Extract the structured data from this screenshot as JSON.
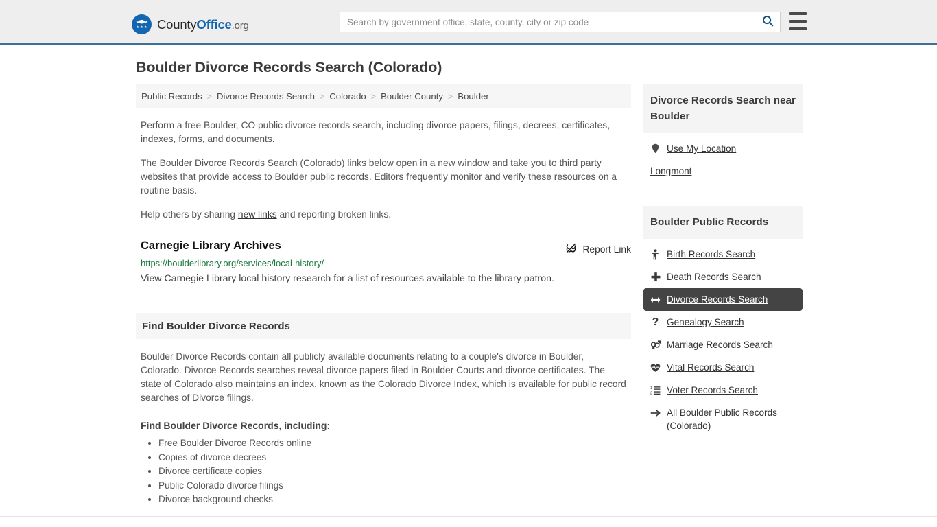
{
  "header": {
    "logo": {
      "icon": "eagle-seal-icon",
      "text_county": "County",
      "text_office": "Office",
      "text_org": ".org"
    },
    "search": {
      "placeholder": "Search by government office, state, county, city or zip code",
      "value": "",
      "icon": "search-icon"
    },
    "menu_icon": "hamburger-menu-icon",
    "accent_color": "#3b7196"
  },
  "main": {
    "title": "Boulder Divorce Records Search (Colorado)",
    "breadcrumb": {
      "separator": ">",
      "items": [
        {
          "label": "Public Records"
        },
        {
          "label": "Divorce Records Search"
        },
        {
          "label": "Colorado"
        },
        {
          "label": "Boulder County"
        },
        {
          "label": "Boulder"
        }
      ]
    },
    "intro_paragraph": "Perform a free Boulder, CO public divorce records search, including divorce papers, filings, decrees, certificates, indexes, forms, and documents.",
    "second_paragraph": "The Boulder Divorce Records Search (Colorado) links below open in a new window and take you to third party websites that provide access to Boulder public records. Editors frequently monitor and verify these resources on a routine basis.",
    "help_prefix": "Help others by sharing ",
    "help_link": "new links",
    "help_suffix": " and reporting broken links.",
    "result": {
      "title": "Carnegie Library Archives",
      "url": "https://boulderlibrary.org/services/local-history/",
      "description": "View Carnegie Library local history research for a list of resources available to the library patron.",
      "report_label": "Report Link",
      "report_icon": "broken-link-icon",
      "url_color": "#1d7a3e"
    },
    "section": {
      "heading": "Find Boulder Divorce Records",
      "body": "Boulder Divorce Records contain all publicly available documents relating to a couple's divorce in Boulder, Colorado. Divorce Records searches reveal divorce papers filed in Boulder Courts and divorce certificates. The state of Colorado also maintains an index, known as the Colorado Divorce Index, which is available for public record searches of Divorce filings.",
      "list_heading": "Find Boulder Divorce Records, including:",
      "bullets": [
        "Free Boulder Divorce Records online",
        "Copies of divorce decrees",
        "Divorce certificate copies",
        "Public Colorado divorce filings",
        "Divorce background checks"
      ]
    }
  },
  "sidebar": {
    "near_card": {
      "heading": "Divorce Records Search near Boulder",
      "items": [
        {
          "label": "Use My Location",
          "icon": "map-pin-icon",
          "active": false
        },
        {
          "label": "Longmont",
          "icon": "",
          "active": false
        }
      ]
    },
    "records_card": {
      "heading": "Boulder Public Records",
      "items": [
        {
          "label": "Birth Records Search",
          "icon": "baby-icon",
          "active": false
        },
        {
          "label": "Death Records Search",
          "icon": "cross-icon",
          "active": false
        },
        {
          "label": "Divorce Records Search",
          "icon": "arrows-left-right-icon",
          "active": true
        },
        {
          "label": "Genealogy Search",
          "icon": "question-mark-icon",
          "active": false
        },
        {
          "label": "Marriage Records Search",
          "icon": "venus-mars-icon",
          "active": false
        },
        {
          "label": "Vital Records Search",
          "icon": "heart-pulse-icon",
          "active": false
        },
        {
          "label": "Voter Records Search",
          "icon": "ordered-list-icon",
          "active": false
        },
        {
          "label": "All Boulder Public Records (Colorado)",
          "icon": "arrow-right-icon",
          "active": false
        }
      ],
      "active_bg": "#444444"
    }
  }
}
